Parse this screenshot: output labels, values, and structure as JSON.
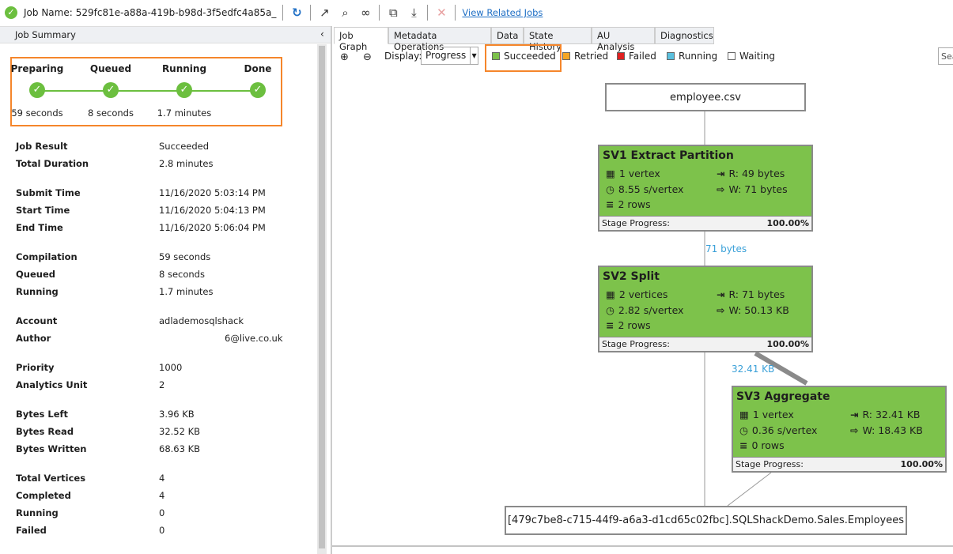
{
  "toolbar": {
    "job_name_label": "Job Name:",
    "job_name": "529fc81e-a88a-419b-b98d-3f5edfc4a85a_",
    "view_related": "View Related Jobs"
  },
  "left_panel": {
    "title": "Job Summary",
    "steps": [
      {
        "label": "Preparing",
        "time": "59 seconds"
      },
      {
        "label": "Queued",
        "time": "8 seconds"
      },
      {
        "label": "Running",
        "time": "1.7 minutes"
      },
      {
        "label": "Done",
        "time": ""
      }
    ],
    "rows": [
      {
        "k": "Job Result",
        "v": "Succeeded"
      },
      {
        "k": "Total Duration",
        "v": "2.8 minutes"
      },
      {
        "k": "Submit Time",
        "v": "11/16/2020 5:03:14 PM"
      },
      {
        "k": "Start Time",
        "v": "11/16/2020 5:04:13 PM"
      },
      {
        "k": "End Time",
        "v": "11/16/2020 5:06:04 PM"
      },
      {
        "k": "Compilation",
        "v": "59 seconds"
      },
      {
        "k": "Queued",
        "v": "8 seconds"
      },
      {
        "k": "Running",
        "v": "1.7 minutes"
      },
      {
        "k": "Account",
        "v": "adlademosqlshack"
      },
      {
        "k": "Author",
        "v": "6@live.co.uk"
      },
      {
        "k": "Priority",
        "v": "1000"
      },
      {
        "k": "Analytics Unit",
        "v": "2"
      },
      {
        "k": "Bytes Left",
        "v": "3.96 KB"
      },
      {
        "k": "Bytes Read",
        "v": "32.52 KB"
      },
      {
        "k": "Bytes Written",
        "v": "68.63 KB"
      },
      {
        "k": "Total Vertices",
        "v": "4"
      },
      {
        "k": "Completed",
        "v": "4"
      },
      {
        "k": "Running",
        "v": "0"
      },
      {
        "k": "Failed",
        "v": "0"
      }
    ]
  },
  "tabs": [
    "Job Graph",
    "Metadata Operations",
    "Data",
    "State History",
    "AU Analysis",
    "Diagnostics"
  ],
  "graph_toolbar": {
    "display_label": "Display:",
    "display_value": "Progress",
    "search_placeholder": "Search",
    "legend": [
      {
        "label": "Succeeded",
        "color": "#7dc24b"
      },
      {
        "label": "Retried",
        "color": "#f5a623"
      },
      {
        "label": "Failed",
        "color": "#e02020"
      },
      {
        "label": "Running",
        "color": "#5bc0de"
      },
      {
        "label": "Waiting",
        "color": "#ffffff"
      }
    ]
  },
  "graph": {
    "input": "employee.csv",
    "output": "[479c7be8-c715-44f9-a6a3-d1cd65c02fbc].SQLShackDemo.Sales.Employees",
    "progress_label": "Stage Progress:",
    "stages": [
      {
        "title": "SV1 Extract Partition",
        "vertices": "1 vertex",
        "time": "8.55 s/vertex",
        "rows": "2 rows",
        "read": "R: 49 bytes",
        "write": "W: 71 bytes",
        "progress": "100.00%"
      },
      {
        "title": "SV2 Split",
        "vertices": "2 vertices",
        "time": "2.82 s/vertex",
        "rows": "2 rows",
        "read": "R: 71 bytes",
        "write": "W: 50.13 KB",
        "progress": "100.00%"
      },
      {
        "title": "SV3 Aggregate",
        "vertices": "1 vertex",
        "time": "0.36 s/vertex",
        "rows": "0 rows",
        "read": "R: 32.41 KB",
        "write": "W: 18.43 KB",
        "progress": "100.00%"
      }
    ],
    "edges": [
      "71 bytes",
      "32.41 KB"
    ]
  }
}
